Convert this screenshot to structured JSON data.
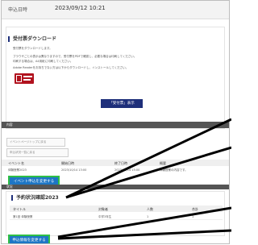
{
  "header": {
    "label": "申込日時",
    "datetime": "2023/09/12 10:21"
  },
  "download_panel": {
    "title": "受付票ダウンロード",
    "lines": [
      "受付票をダウンロードします。",
      "ブラウザごとの表示は異なりますので、受付票をPDFで確認し、必要な場合は印刷してください。",
      "印刷する場合は、A4用紙に印刷してください。",
      "Adobe Readerをお持ちでない方は以下からダウンロードし、インストールしてください。"
    ],
    "adobe_badge": "Adobe Reader",
    "button": "「受付票」表示"
  },
  "ghost_buttons": [
    "イベントページトップに戻る",
    "申込状況一覧に戻る"
  ],
  "event_table": {
    "bar_label": "内容",
    "headers": [
      "イベント名",
      "開始日時",
      "終了日時",
      "概要"
    ],
    "row": [
      "体験授業2023",
      "2023/10/14 13:00",
      "2023/10/14 15:00",
      "体験授業の内容です。"
    ]
  },
  "change_button": "イベント申込を変更する",
  "status_bar": "状況",
  "schedule_panel": {
    "title": "予約状況確認2023",
    "headers": [
      "タイトル",
      "対象者",
      "人数",
      "合計"
    ],
    "rows": [
      [
        "第1回 体験授業",
        "中学3年生",
        "1",
        "1"
      ]
    ]
  },
  "confirm_button": "申込情報を変更する",
  "colors": {
    "navy": "#1e2f7a",
    "action_blue": "#1d76c5",
    "highlight_green": "#2fbf46",
    "adobe_red": "#b1121e"
  }
}
